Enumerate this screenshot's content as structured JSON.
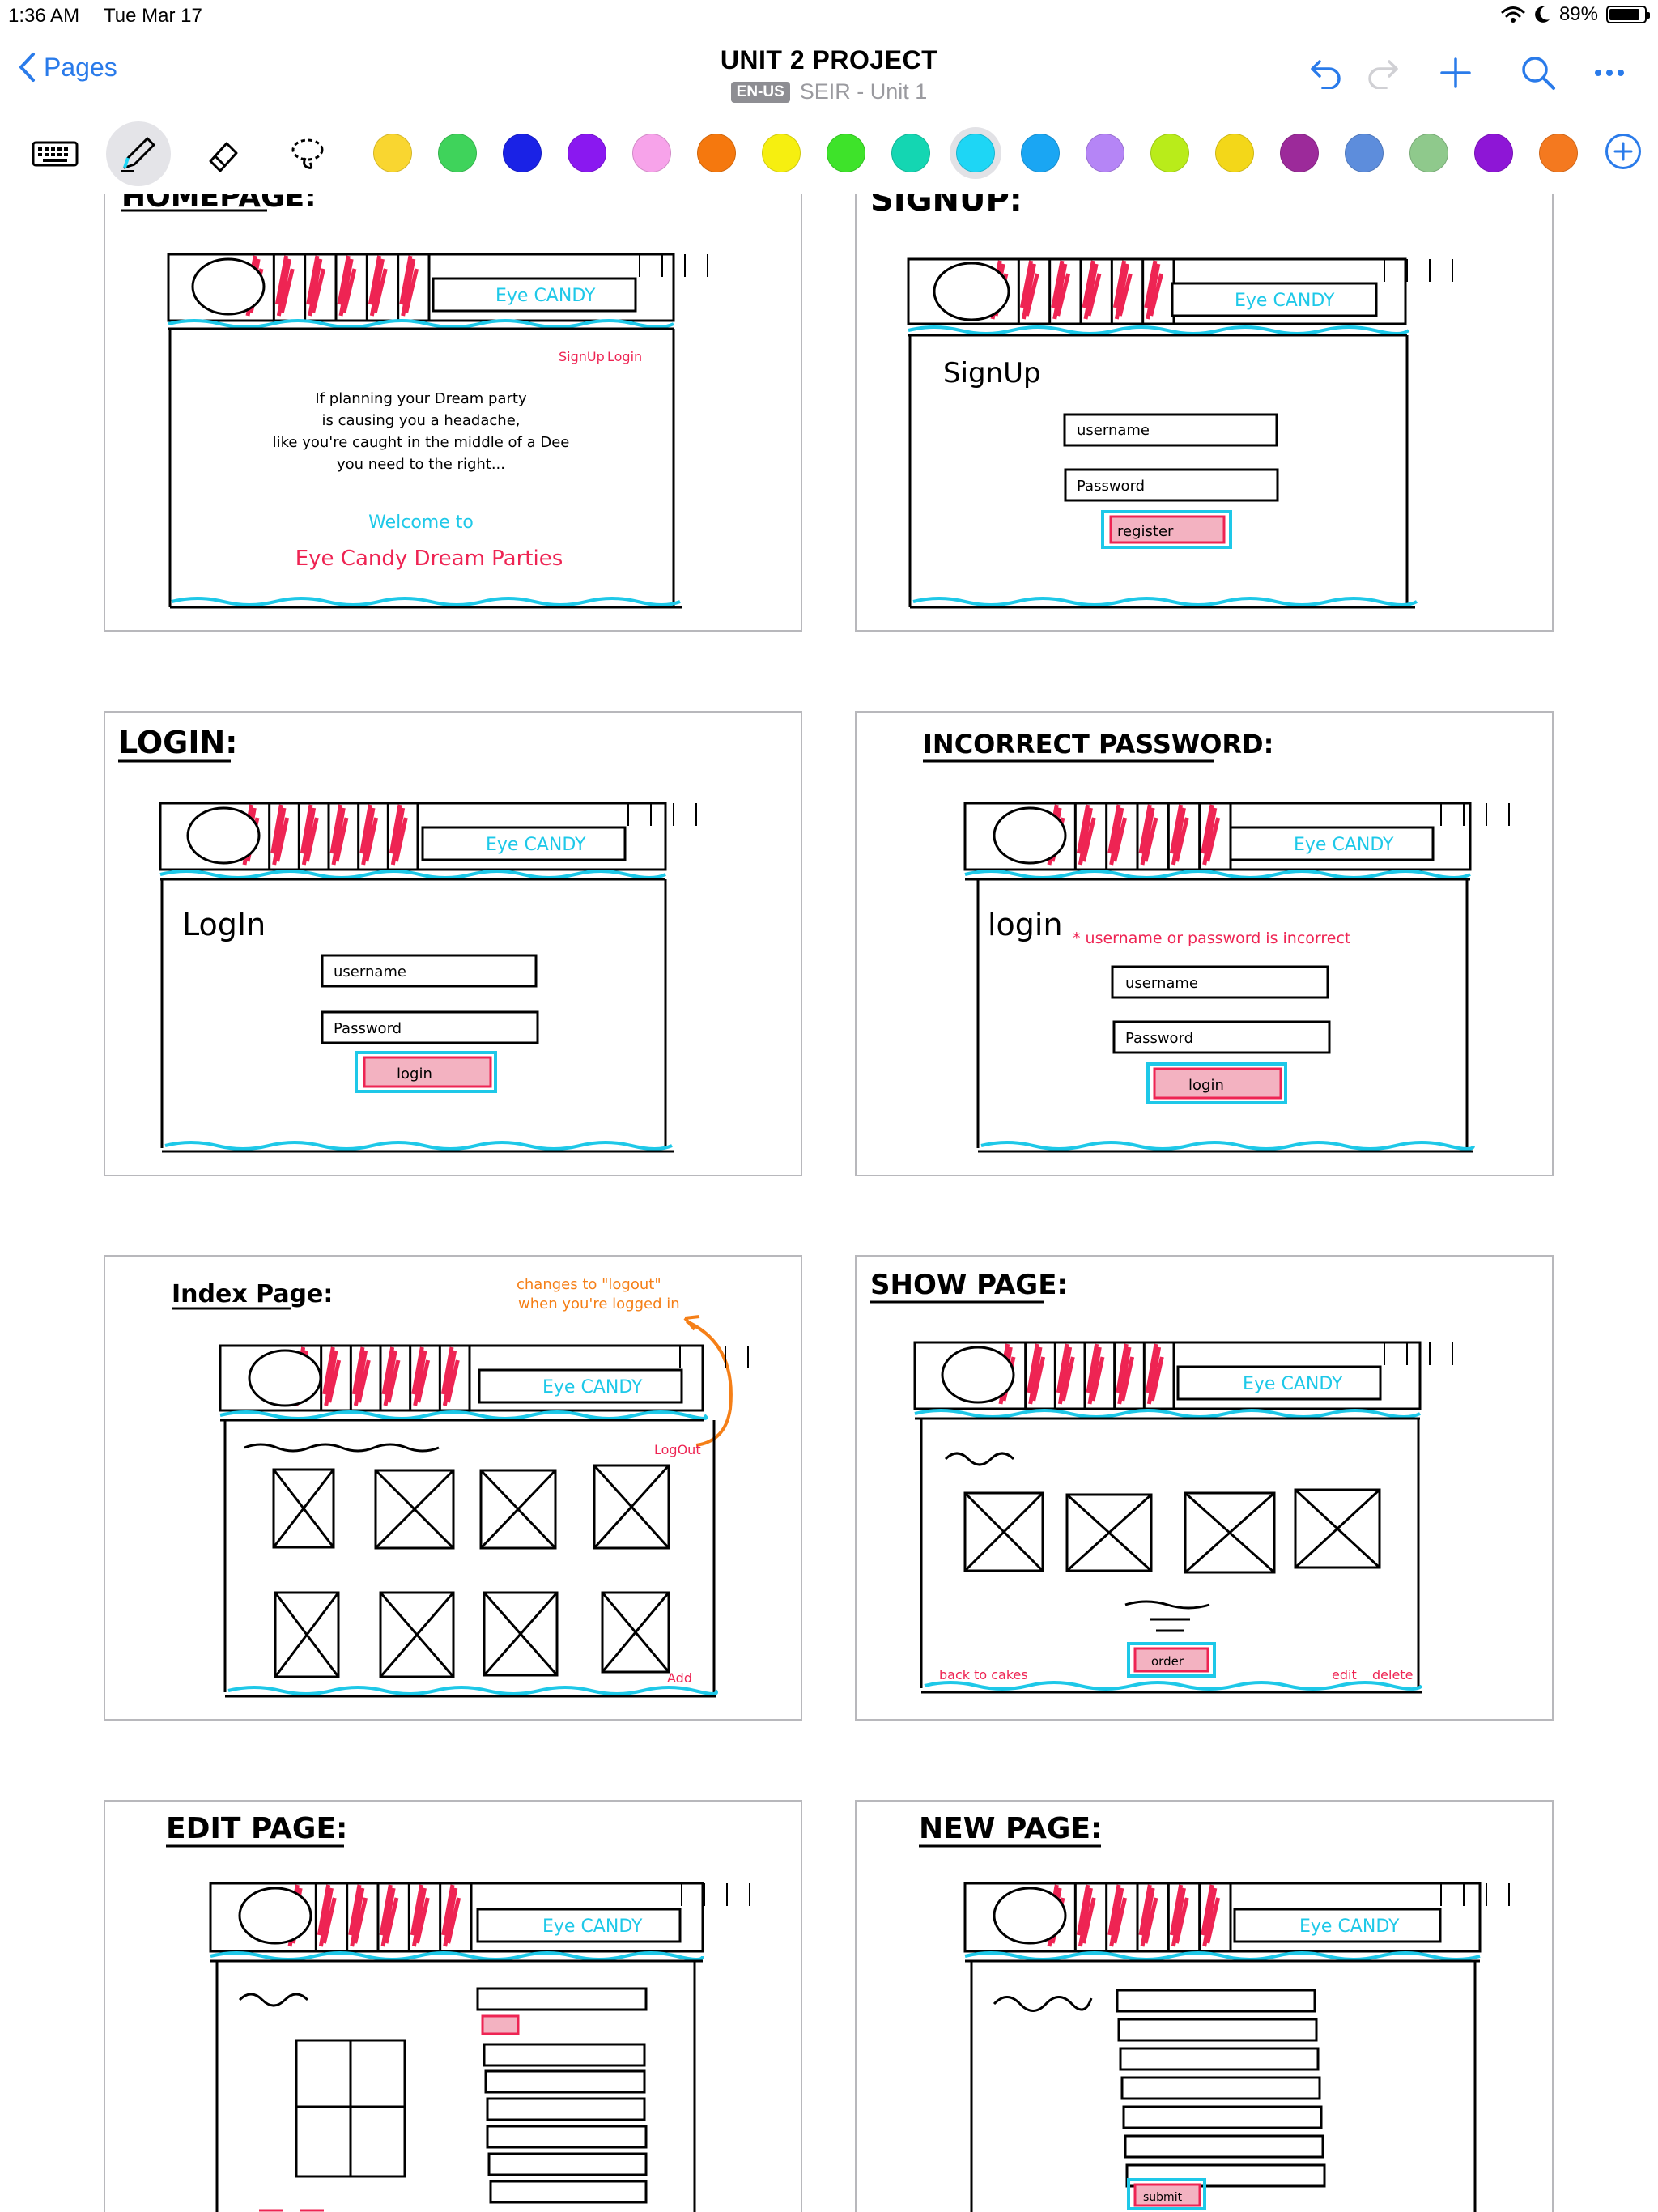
{
  "status": {
    "time": "1:36 AM",
    "date": "Tue Mar 17",
    "battery": "89%",
    "battery_level": 0.89
  },
  "nav": {
    "back_label": "Pages",
    "title": "UNIT 2 PROJECT",
    "language": "EN-US",
    "subtitle": "SEIR - Unit 1",
    "actions": [
      "undo-icon",
      "redo-icon",
      "add-icon",
      "search-icon",
      "more-icon"
    ]
  },
  "toolbar": {
    "tools": [
      "keyboard-icon",
      "pen-icon",
      "eraser-icon",
      "lasso-icon"
    ],
    "active_tool": "pen-icon",
    "colors": [
      "#f9d630",
      "#3fd35b",
      "#1a22e6",
      "#8a18f0",
      "#f7a3ea",
      "#f5780e",
      "#f6ef10",
      "#3ee32a",
      "#14d6b2",
      "#1ed6f5",
      "#1aa6f3",
      "#b585f6",
      "#b9ec1a",
      "#f3d719",
      "#9c2a9a",
      "#5d8ddc",
      "#8fc98c",
      "#8e16d6",
      "#f4791f"
    ],
    "selected_color": "#1ed6f5"
  },
  "wireframe": {
    "brand": "Eye CANDY",
    "pages": [
      {
        "heading": "HOMEPAGE:",
        "body": [
          "If planning your Dream party",
          "is causing you a headache,",
          "like you're caught in the middle of a Dee",
          "you need to the right...",
          "Welcome to",
          "Eye Candy Dream Parties"
        ],
        "links": [
          "SignUp",
          "Login"
        ]
      },
      {
        "heading": "SIGNUP:",
        "form_title": "SignUp",
        "fields": [
          "username",
          "Password"
        ],
        "button": "register"
      },
      {
        "heading": "LOGIN:",
        "form_title": "LogIn",
        "fields": [
          "username",
          "Password"
        ],
        "button": "login"
      },
      {
        "heading": "INCORRECT PASSWORD:",
        "form_title": "login",
        "error": "* username or password is incorrect",
        "fields": [
          "username",
          "Password"
        ],
        "button": "login"
      },
      {
        "heading": "Index Page:",
        "note": [
          "changes to \"logout\"",
          "when you're logged in"
        ],
        "link": "LogOut",
        "footer_link": "Add"
      },
      {
        "heading": "SHOW PAGE:",
        "button": "order",
        "links": [
          "back to cakes",
          "edit",
          "delete"
        ]
      },
      {
        "heading": "EDIT PAGE:"
      },
      {
        "heading": "NEW PAGE:",
        "button": "submit"
      }
    ]
  }
}
